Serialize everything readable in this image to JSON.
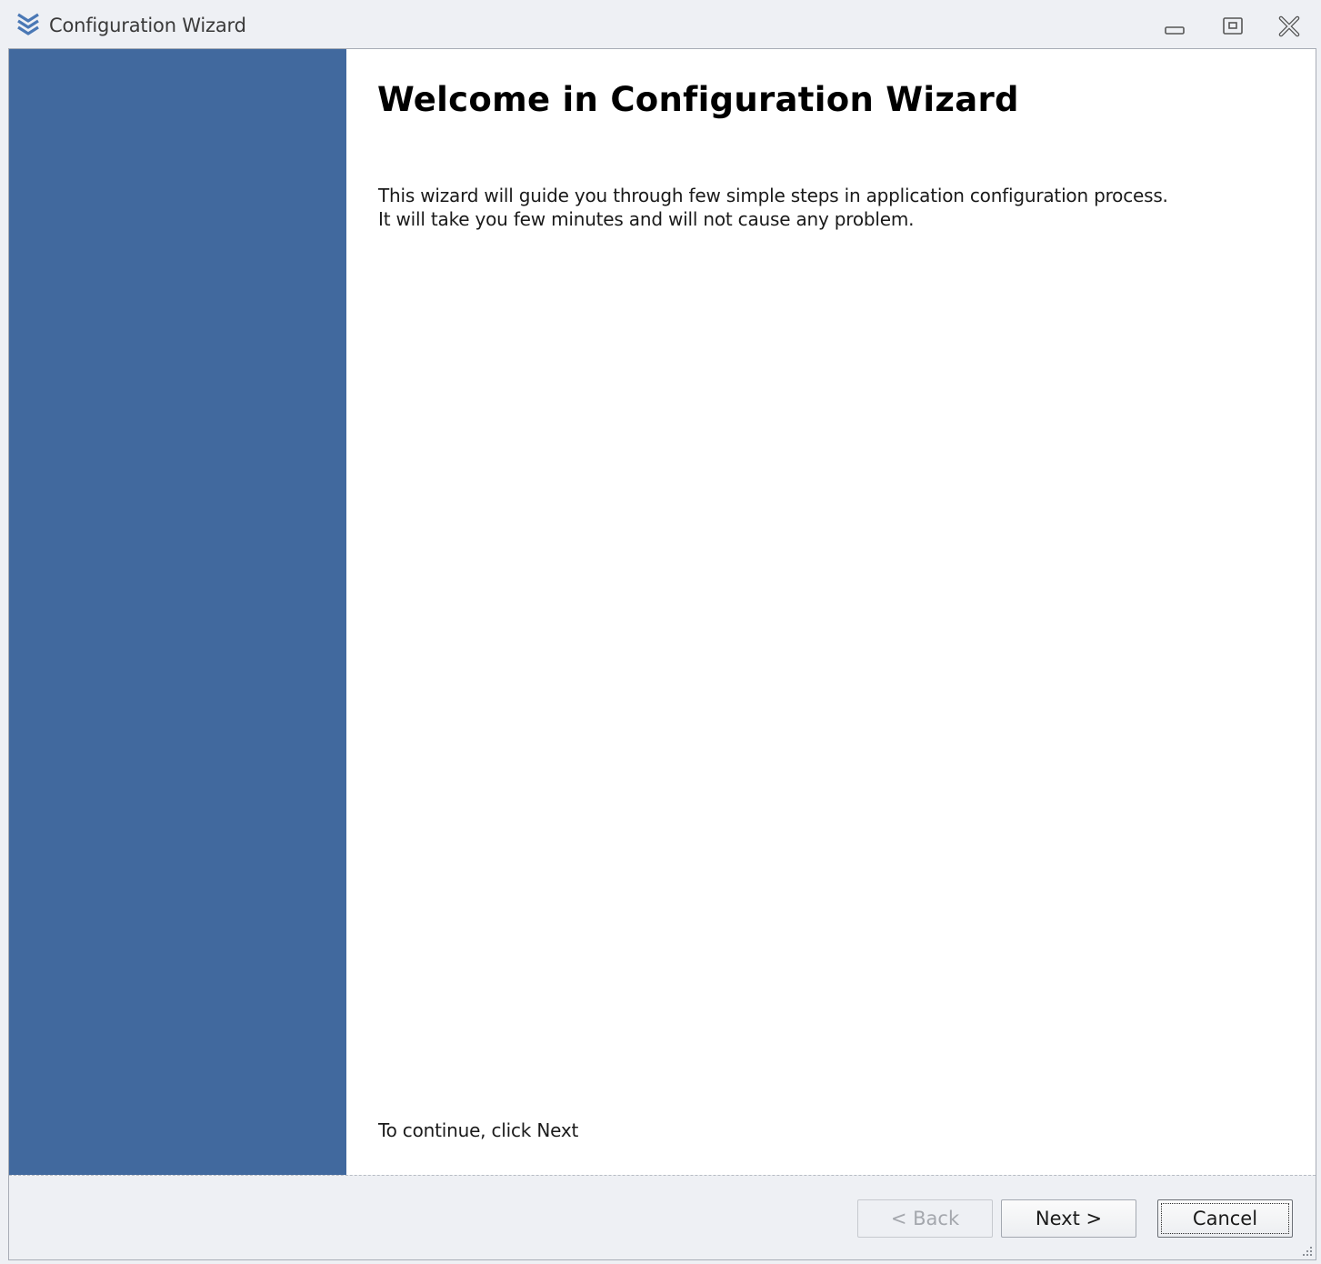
{
  "window": {
    "title": "Configuration Wizard",
    "controls": {
      "minimize_icon": "minimize-icon",
      "restore_icon": "restore-icon",
      "close_icon": "close-icon"
    }
  },
  "content": {
    "heading": "Welcome in Configuration Wizard",
    "description_line1": "This wizard will guide you through few simple steps in application configuration process.",
    "description_line2": "It will take you few minutes and will not cause any problem.",
    "continue_hint": "To continue, click Next"
  },
  "buttons": {
    "back": {
      "label": "< Back",
      "enabled": false
    },
    "next": {
      "label": "Next >",
      "enabled": true
    },
    "cancel": {
      "label": "Cancel",
      "enabled": true,
      "focused": true
    }
  },
  "colors": {
    "sidebar": "#41699e",
    "window_bg": "#eef0f4",
    "accent": "#3f6aa5"
  }
}
